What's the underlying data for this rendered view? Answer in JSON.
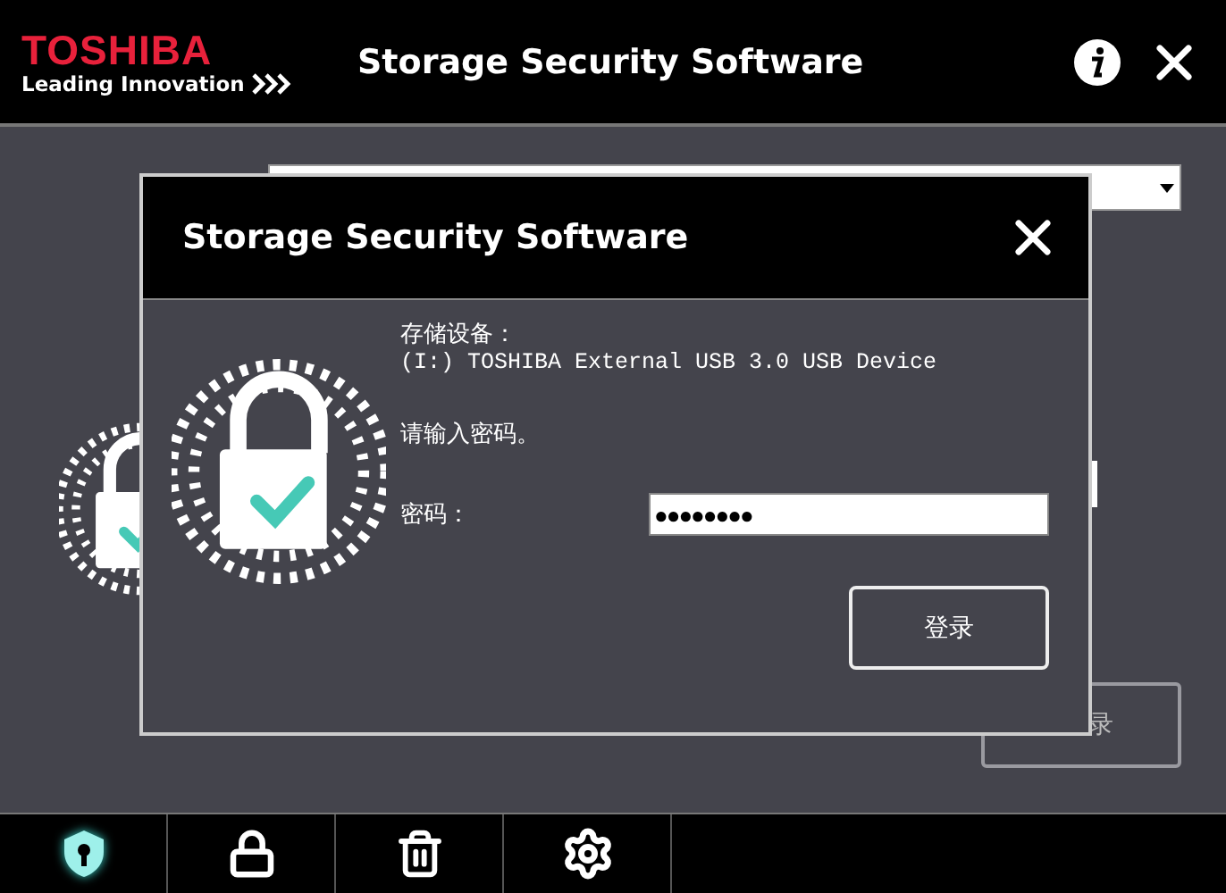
{
  "window": {
    "brand": "TOSHIBA",
    "tagline": "Leading Innovation",
    "title": "Storage Security Software"
  },
  "main": {
    "login_button": "录"
  },
  "dialog": {
    "title": "Storage Security Software",
    "device_label": "存储设备：",
    "device": "(I:) TOSHIBA External USB 3.0 USB Device",
    "prompt": "请输入密码。",
    "password_label": "密码：",
    "password": "●●●●●●●●",
    "login_button": "登录"
  },
  "nav": [
    {
      "kind": "unlock",
      "selected": true
    },
    {
      "kind": "lock",
      "selected": false
    },
    {
      "kind": "delete",
      "selected": false
    },
    {
      "kind": "settings",
      "selected": false
    }
  ]
}
